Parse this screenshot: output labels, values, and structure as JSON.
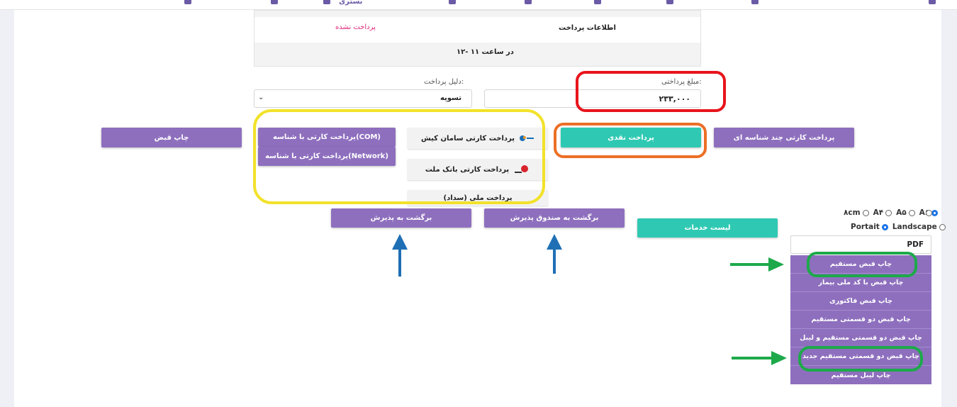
{
  "topbar": {
    "partial_label": "بستری"
  },
  "payment_info": {
    "title": "اطلاعات پرداخت",
    "status": "پرداخت نشده",
    "time": "در ساعت ۱۱ -۱۲"
  },
  "form": {
    "amount_label": "مبلغ پرداختی:",
    "amount_value": "۲۳۳,۰۰۰",
    "reason_label": "دلیل پرداخت:",
    "reason_value": "تسویه"
  },
  "buttons": {
    "multi_card": "پرداخت کارتی چند شناسه ای",
    "cash": "پرداخت نقدی",
    "saman": "پرداخت کارتی سامان کیش",
    "mellat": "پرداخت کارتی بانک ملت",
    "melli": "پرداخت ملی (سداد)",
    "card_com": "پرداخت کارتی با شناسه(COM)",
    "card_network": "پرداخت کارتی با شناسه(Network)",
    "print_receipt": "چاپ قبض",
    "back_cashbox": "برگشت به صندوق پذیرش",
    "back_admission": "برگشت به پذیرش",
    "service_list": "لیست خدمات"
  },
  "paper_options": [
    "A۶",
    "A۵",
    "A۴",
    "۸cm"
  ],
  "orientation_options": [
    "Landscape",
    "Portait"
  ],
  "format_value": "PDF",
  "print_menu": [
    "چاپ قبض مستقیم",
    "چاپ قبض با کد ملی بیمار",
    "چاپ قبض فاکتوری",
    "چاپ قبض دو قسمتی مستقیم",
    "چاپ قبض دو قسمتی مستقیم و لیبل",
    "چاپ قبض دو قسمتی مستقیم جدید",
    "چاپ لیبل مستقیم"
  ],
  "colors": {
    "purple": "#8e6fbe",
    "teal": "#2fc9b3",
    "status_pink": "#e0287a",
    "annot_red": "#e8141c",
    "annot_yellow": "#f2e22a",
    "annot_orange": "#ec6f26",
    "annot_green": "#1da94a",
    "annot_blue": "#1f6fb5"
  }
}
